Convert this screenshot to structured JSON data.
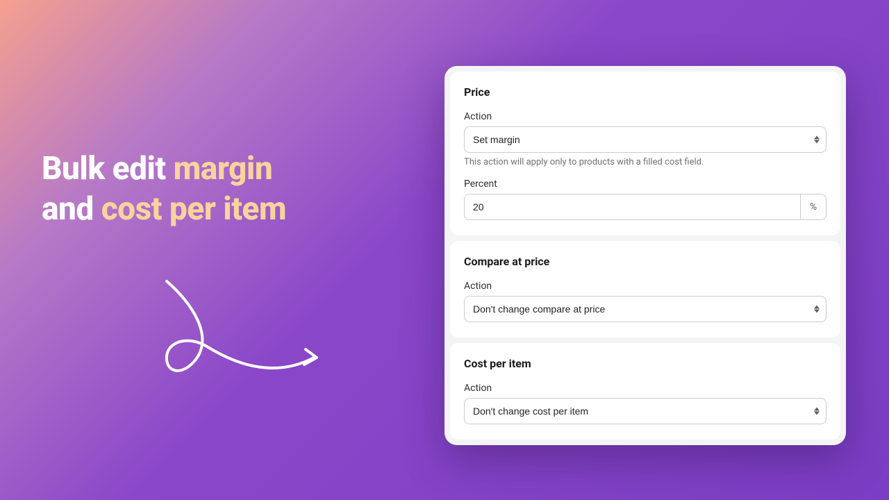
{
  "hero": {
    "line1_prefix": "Bulk edit ",
    "line1_accent": "margin",
    "line2_prefix": "and ",
    "line2_accent": "cost per item"
  },
  "panel": {
    "price": {
      "title": "Price",
      "action_label": "Action",
      "action_value": "Set margin",
      "helper": "This action will apply only to products with a filled cost field.",
      "percent_label": "Percent",
      "percent_value": "20",
      "percent_suffix": "%"
    },
    "compare": {
      "title": "Compare at price",
      "action_label": "Action",
      "action_value": "Don't change compare at price"
    },
    "cost": {
      "title": "Cost per item",
      "action_label": "Action",
      "action_value": "Don't change cost per item"
    }
  }
}
